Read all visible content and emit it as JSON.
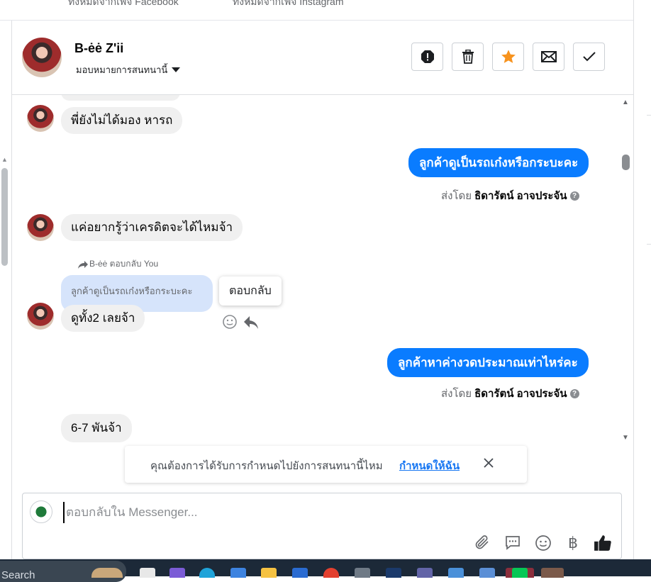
{
  "top_tabs": [
    "ทั้งหมดจากเพจ Facebook",
    "ทั้งหมดจากเพจ Instagram"
  ],
  "header": {
    "name": "B-ėė Z'ii",
    "assign_label": "มอบหมายการสนทนานี้",
    "actions": [
      "spam-icon",
      "trash-icon",
      "star-icon",
      "mail-icon",
      "check-icon"
    ],
    "star_color": "#f7931e"
  },
  "messages": {
    "m1": "พี่ยังไม่ได้มอง หารถ",
    "m2": "ลูกค้าดูเป็นรถเก๋งหรือกระบะคะ",
    "m2_prefix": "ส่งโดย",
    "m2_sender": "ธิดารัตน์ อาจประจัน",
    "m3": "แค่อยากรู้ว่าเครดิตจะได้ไหมจ้า",
    "reply_hint": "B-ėė ตอบกลับ You",
    "quoted": "ลูกค้าดูเป็นรถเก๋งหรือกระบะคะ",
    "tooltip": "ตอบกลับ",
    "m4": "ดูทั้ง2 เลยจ้า",
    "m5": "ลูกค้าหาค่างวดประมาณเท่าไหร่คะ",
    "m5_prefix": "ส่งโดย",
    "m5_sender": "ธิดารัตน์ อาจประจัน",
    "m6": "6-7 พันจ้า"
  },
  "assign_banner": {
    "question": "คุณต้องการได้รับการกำหนดไปยังการสนทนานี้ไหม",
    "link": "กำหนดให้ฉัน"
  },
  "composer": {
    "placeholder": "ตอบกลับใน Messenger...",
    "tools": [
      "paperclip-icon",
      "saved-replies-icon",
      "emoji-icon",
      "baht-icon",
      "thumbs-up-icon"
    ],
    "baht": "฿"
  },
  "taskbar": {
    "search": "Search"
  },
  "colors": {
    "accent": "#0a7cff",
    "incoming": "#f0f0f0",
    "quoted": "#d6e4fb"
  }
}
